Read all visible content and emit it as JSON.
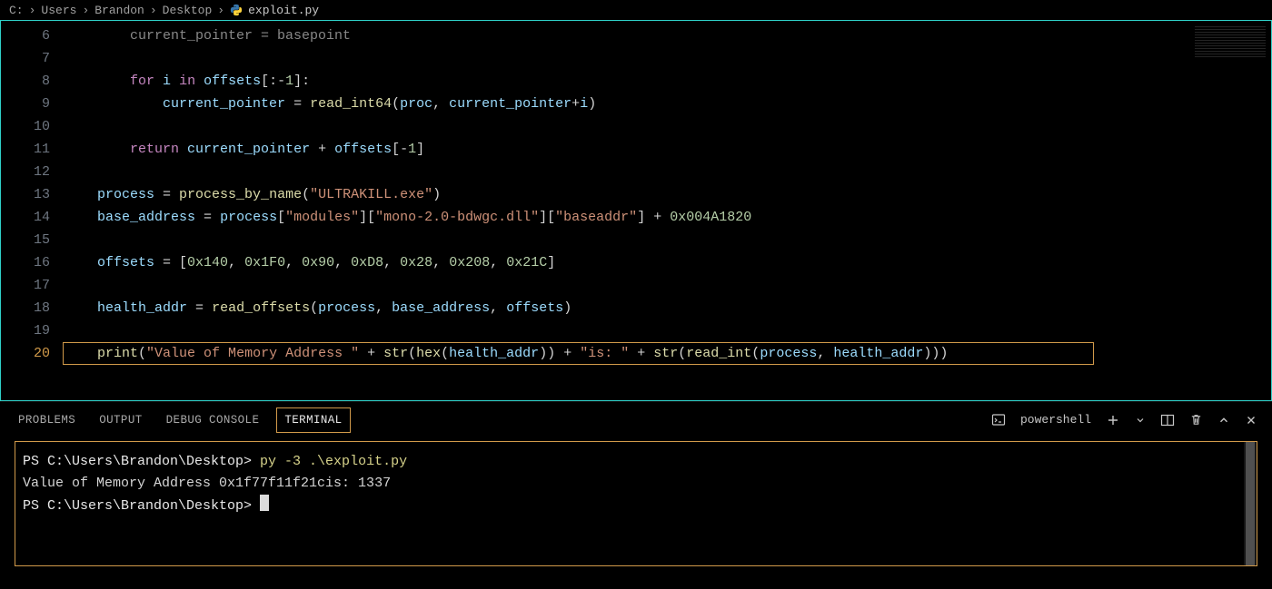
{
  "breadcrumbs": [
    "C:",
    "Users",
    "Brandon",
    "Desktop",
    "exploit.py"
  ],
  "file_icon": "python-icon",
  "editor": {
    "lines": [
      {
        "n": 6,
        "tokens": [
          [
            "op",
            "        "
          ],
          [
            "cfade",
            "current_pointer = basepoint"
          ]
        ]
      },
      {
        "n": 7,
        "tokens": []
      },
      {
        "n": 8,
        "tokens": [
          [
            "op",
            "        "
          ],
          [
            "kw",
            "for"
          ],
          [
            "op",
            " "
          ],
          [
            "var",
            "i"
          ],
          [
            "op",
            " "
          ],
          [
            "kw",
            "in"
          ],
          [
            "op",
            " "
          ],
          [
            "var",
            "offsets"
          ],
          [
            "op",
            "[:"
          ],
          [
            "op",
            "-"
          ],
          [
            "num",
            "1"
          ],
          [
            "op",
            "]:"
          ]
        ]
      },
      {
        "n": 9,
        "tokens": [
          [
            "op",
            "            "
          ],
          [
            "var",
            "current_pointer"
          ],
          [
            "op",
            " = "
          ],
          [
            "fn",
            "read_int64"
          ],
          [
            "op",
            "("
          ],
          [
            "var",
            "proc"
          ],
          [
            "op",
            ", "
          ],
          [
            "var",
            "current_pointer"
          ],
          [
            "op",
            "+"
          ],
          [
            "var",
            "i"
          ],
          [
            "op",
            ")"
          ]
        ]
      },
      {
        "n": 10,
        "tokens": []
      },
      {
        "n": 11,
        "tokens": [
          [
            "op",
            "        "
          ],
          [
            "kw",
            "return"
          ],
          [
            "op",
            " "
          ],
          [
            "var",
            "current_pointer"
          ],
          [
            "op",
            " + "
          ],
          [
            "var",
            "offsets"
          ],
          [
            "op",
            "["
          ],
          [
            "op",
            "-"
          ],
          [
            "num",
            "1"
          ],
          [
            "op",
            "]"
          ]
        ]
      },
      {
        "n": 12,
        "tokens": []
      },
      {
        "n": 13,
        "tokens": [
          [
            "op",
            "    "
          ],
          [
            "var",
            "process"
          ],
          [
            "op",
            " = "
          ],
          [
            "fn",
            "process_by_name"
          ],
          [
            "op",
            "("
          ],
          [
            "str",
            "\"ULTRAKILL.exe\""
          ],
          [
            "op",
            ")"
          ]
        ]
      },
      {
        "n": 14,
        "tokens": [
          [
            "op",
            "    "
          ],
          [
            "var",
            "base_address"
          ],
          [
            "op",
            " = "
          ],
          [
            "var",
            "process"
          ],
          [
            "op",
            "["
          ],
          [
            "str",
            "\"modules\""
          ],
          [
            "op",
            "]["
          ],
          [
            "str",
            "\"mono-2.0-bdwgc.dll\""
          ],
          [
            "op",
            "]["
          ],
          [
            "str",
            "\"baseaddr\""
          ],
          [
            "op",
            "] + "
          ],
          [
            "num",
            "0x004A1820"
          ]
        ]
      },
      {
        "n": 15,
        "tokens": []
      },
      {
        "n": 16,
        "tokens": [
          [
            "op",
            "    "
          ],
          [
            "var",
            "offsets"
          ],
          [
            "op",
            " = ["
          ],
          [
            "num",
            "0x140"
          ],
          [
            "op",
            ", "
          ],
          [
            "num",
            "0x1F0"
          ],
          [
            "op",
            ", "
          ],
          [
            "num",
            "0x90"
          ],
          [
            "op",
            ", "
          ],
          [
            "num",
            "0xD8"
          ],
          [
            "op",
            ", "
          ],
          [
            "num",
            "0x28"
          ],
          [
            "op",
            ", "
          ],
          [
            "num",
            "0x208"
          ],
          [
            "op",
            ", "
          ],
          [
            "num",
            "0x21C"
          ],
          [
            "op",
            "]"
          ]
        ]
      },
      {
        "n": 17,
        "tokens": []
      },
      {
        "n": 18,
        "tokens": [
          [
            "op",
            "    "
          ],
          [
            "var",
            "health_addr"
          ],
          [
            "op",
            " = "
          ],
          [
            "fn",
            "read_offsets"
          ],
          [
            "op",
            "("
          ],
          [
            "var",
            "process"
          ],
          [
            "op",
            ", "
          ],
          [
            "var",
            "base_address"
          ],
          [
            "op",
            ", "
          ],
          [
            "var",
            "offsets"
          ],
          [
            "op",
            ")"
          ]
        ]
      },
      {
        "n": 19,
        "tokens": []
      },
      {
        "n": 20,
        "active": true,
        "tokens": [
          [
            "op",
            "    "
          ],
          [
            "fn",
            "print"
          ],
          [
            "op",
            "("
          ],
          [
            "str",
            "\"Value of Memory Address \""
          ],
          [
            "op",
            " + "
          ],
          [
            "fn",
            "str"
          ],
          [
            "op",
            "("
          ],
          [
            "fn",
            "hex"
          ],
          [
            "op",
            "("
          ],
          [
            "var",
            "health_addr"
          ],
          [
            "op",
            ")) + "
          ],
          [
            "str",
            "\"is: \""
          ],
          [
            "op",
            " + "
          ],
          [
            "fn",
            "str"
          ],
          [
            "op",
            "("
          ],
          [
            "fn",
            "read_int"
          ],
          [
            "op",
            "("
          ],
          [
            "var",
            "process"
          ],
          [
            "op",
            ", "
          ],
          [
            "var",
            "health_addr"
          ],
          [
            "op",
            ")))"
          ]
        ]
      }
    ]
  },
  "panel": {
    "tabs": [
      "PROBLEMS",
      "OUTPUT",
      "DEBUG CONSOLE",
      "TERMINAL"
    ],
    "active_tab": "TERMINAL",
    "shell_label": "powershell"
  },
  "terminal": {
    "lines": [
      {
        "parts": [
          [
            "prompt",
            "PS C:\\Users\\Brandon\\Desktop> "
          ],
          [
            "cmd",
            "py -3 .\\exploit.py"
          ]
        ]
      },
      {
        "parts": [
          [
            "out",
            "Value of Memory Address 0x1f77f11f21cis: 1337"
          ]
        ]
      },
      {
        "parts": [
          [
            "prompt",
            "PS C:\\Users\\Brandon\\Desktop> "
          ],
          [
            "cursor",
            ""
          ]
        ]
      }
    ]
  }
}
